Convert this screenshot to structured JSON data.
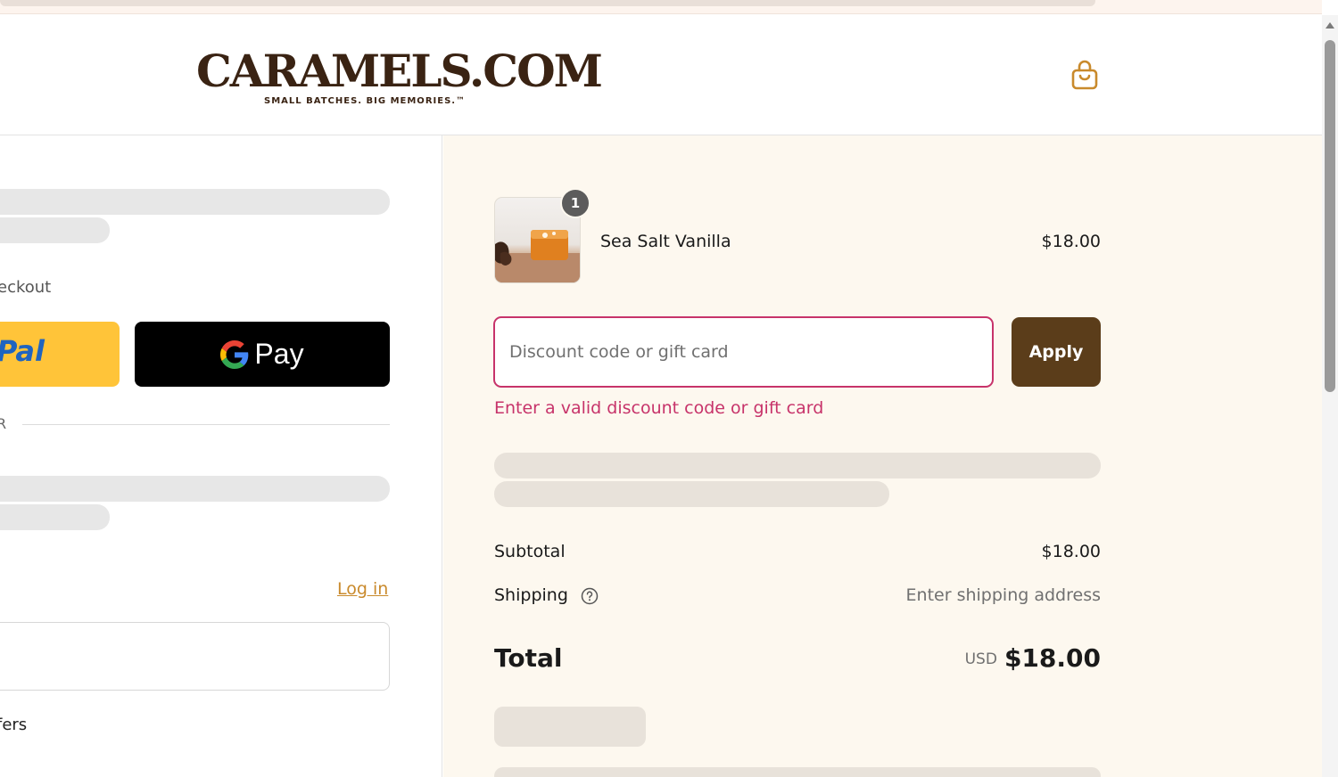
{
  "brand": {
    "logo_text": "CARAMELS.COM",
    "tagline": "SMALL BATCHES. BIG MEMORIES.™"
  },
  "header": {
    "cart_icon": "shopping-bag-icon"
  },
  "left": {
    "express_checkout_label": "eckout",
    "paypal_label": "Pal",
    "gpay_label": "Pay",
    "or_divider": "R",
    "login_link": "Log in",
    "offers_text": "fers"
  },
  "order": {
    "item": {
      "name": "Sea Salt Vanilla",
      "price": "$18.00",
      "quantity": "1"
    },
    "discount": {
      "placeholder": "Discount code or gift card",
      "value": "",
      "apply_label": "Apply",
      "error": "Enter a valid discount code or gift card"
    },
    "subtotal_label": "Subtotal",
    "subtotal_value": "$18.00",
    "shipping_label": "Shipping",
    "shipping_value": "Enter shipping address",
    "total_label": "Total",
    "total_currency": "USD",
    "total_value": "$18.00"
  },
  "colors": {
    "brand_brown": "#5b3d1a",
    "error_pink": "#c7336a",
    "link_gold": "#c98a2c",
    "summary_bg": "#fdf8ef",
    "paypal_yellow": "#ffc439"
  }
}
